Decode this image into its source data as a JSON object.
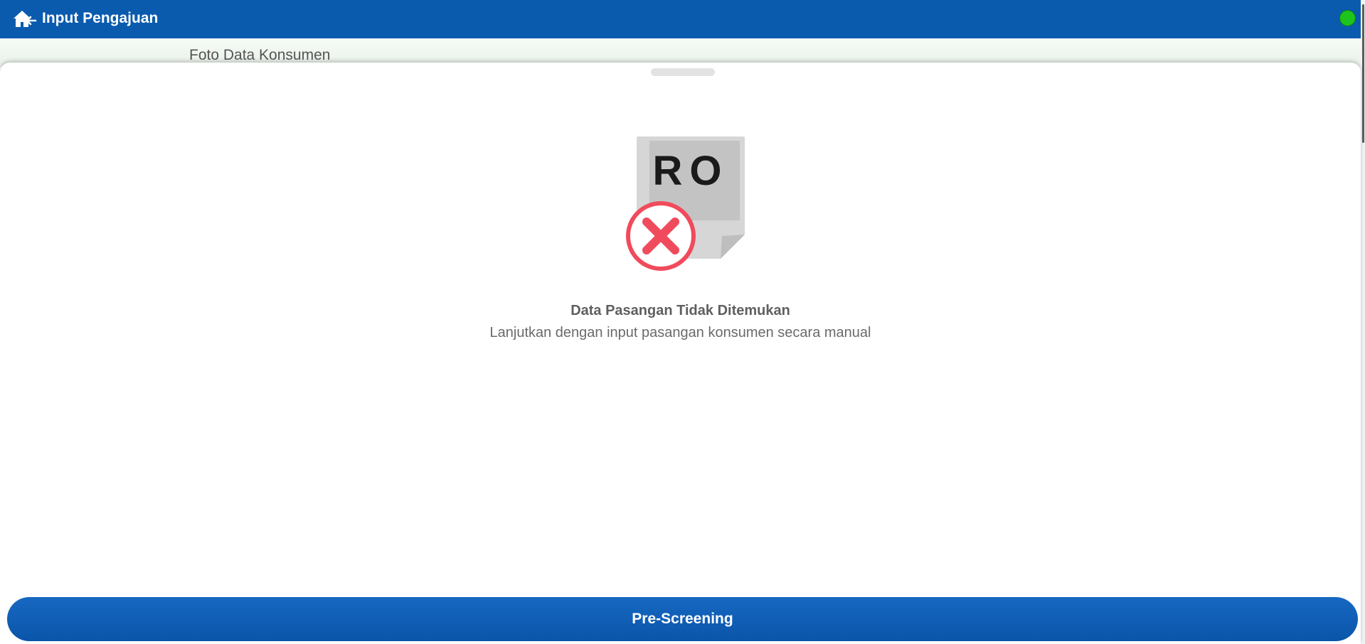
{
  "header": {
    "title": "Input Pengajuan",
    "back_icon": "home-back-icon",
    "status_color": "#1ec41e"
  },
  "background_section": {
    "label": "Foto Data Konsumen"
  },
  "sheet": {
    "illustration": {
      "doc_text": "RO",
      "error_icon": "x-circle-icon",
      "error_color": "#f04b5c"
    },
    "title": "Data Pasangan Tidak Ditemukan",
    "description": "Lanjutkan dengan input pasangan konsumen secara manual"
  },
  "footer": {
    "button_label": "Pre-Screening"
  },
  "colors": {
    "primary": "#0a5bae"
  }
}
